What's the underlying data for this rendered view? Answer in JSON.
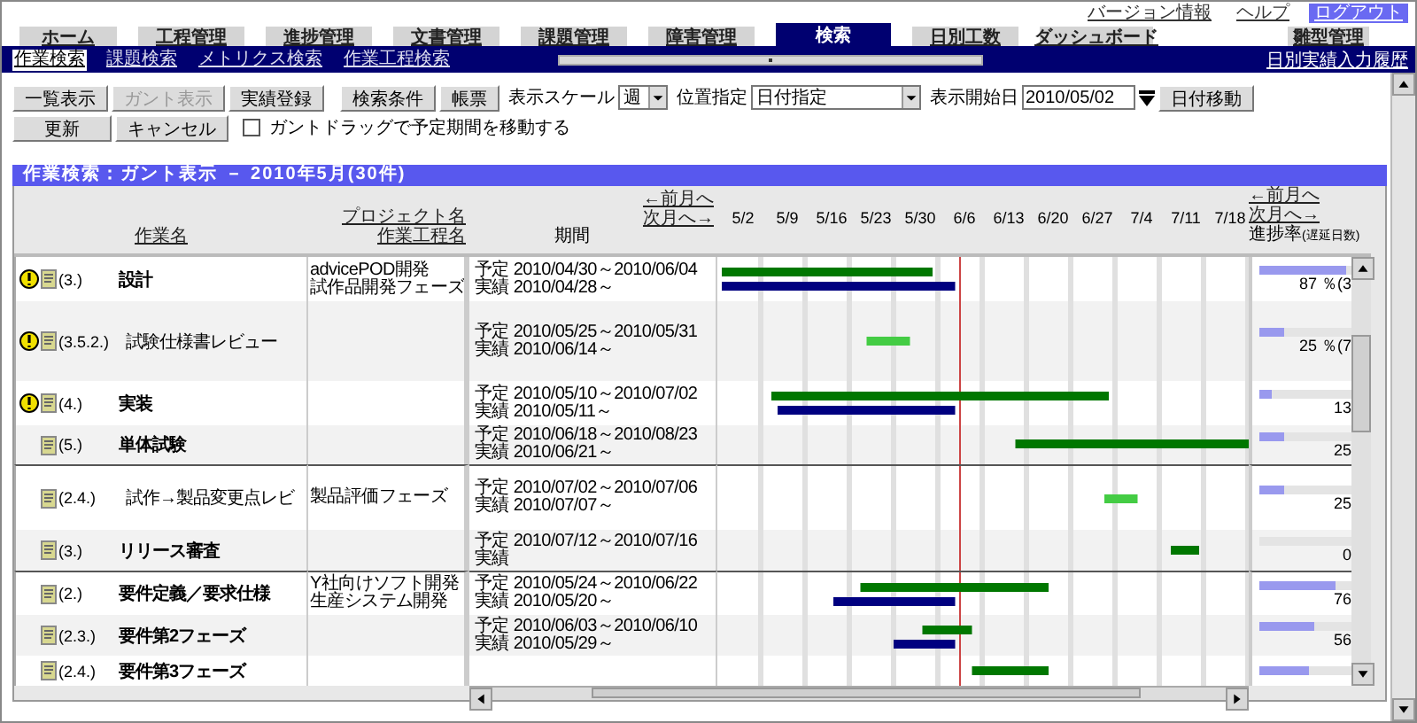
{
  "top_links": [
    {
      "label": "バージョン情報",
      "selected": false
    },
    {
      "label": "ヘルプ",
      "selected": false
    },
    {
      "label": "ログアウト",
      "selected": true
    }
  ],
  "tabs": [
    {
      "label": "ホーム",
      "selected": false
    },
    {
      "label": "工程管理",
      "selected": false
    },
    {
      "label": "進捗管理",
      "selected": false
    },
    {
      "label": "文書管理",
      "selected": false
    },
    {
      "label": "課題管理",
      "selected": false
    },
    {
      "label": "障害管理",
      "selected": false
    },
    {
      "label": "検索",
      "selected": true
    },
    {
      "label": "日別工数",
      "selected": false
    },
    {
      "label": "ダッシュボード",
      "selected": false
    }
  ],
  "tabs_right": [
    {
      "label": "雛型管理",
      "selected": false
    }
  ],
  "subtabs": [
    {
      "label": "作業検索",
      "selected": true
    },
    {
      "label": "課題検索",
      "selected": false
    },
    {
      "label": "メトリクス検索",
      "selected": false
    },
    {
      "label": "作業工程検索",
      "selected": false
    }
  ],
  "subnav_link": "日別実績入力履歴",
  "toolbar": {
    "buttons_row1": [
      {
        "label": "一覧表示",
        "disabled": false
      },
      {
        "label": "ガント表示",
        "disabled": true
      },
      {
        "label": "実績登録",
        "disabled": false
      },
      {
        "label": "検索条件",
        "disabled": false
      },
      {
        "label": "帳票",
        "disabled": false
      }
    ],
    "scale_label": "表示スケール",
    "scale_value": "週",
    "position_label": "位置指定",
    "position_value": "日付指定",
    "start_label": "表示開始日",
    "start_value": "2010/05/02",
    "move_button": "日付移動",
    "buttons_row2": [
      {
        "label": "更新",
        "disabled": false
      },
      {
        "label": "キャンセル",
        "disabled": false
      }
    ],
    "drag_option": {
      "label": "ガントドラッグで予定期間を移動する",
      "checked": false
    }
  },
  "panel_title": "作業検索：ガント表示 － 2010年5月(30件)",
  "header": {
    "task": "作業名",
    "project": "プロジェクト名",
    "phase": "作業工程名",
    "period": "期間",
    "prev": "←前月へ",
    "next": "次月へ→",
    "weeks": [
      "5/2",
      "5/9",
      "5/16",
      "5/23",
      "5/30",
      "6/6",
      "6/13",
      "6/20",
      "6/27",
      "7/4",
      "7/11",
      "7/18"
    ],
    "progress_prev": "←前月へ",
    "progress_next": "次月へ→",
    "progress": "進捗率",
    "progress_note": "(遅延日数)"
  },
  "rows": [
    {
      "alert": true,
      "summary": true,
      "number": "(3.)",
      "name": "設計",
      "project": "advicePOD開発",
      "phase": "試作品開発フェーズ",
      "plan": "予定 2010/04/30～2010/06/04",
      "actual": "実績 2010/04/28～",
      "level": 0.87,
      "progress": "87 ％(3"
    },
    {
      "alert": true,
      "summary": false,
      "number": "(3.5.2.)",
      "name": "試験仕様書レビュー",
      "plan": "予定 2010/05/25～2010/05/31",
      "actual": "実績 2010/06/14～",
      "level": 0.25,
      "progress": "25 ％(7"
    },
    {
      "alert": true,
      "summary": true,
      "number": "(4.)",
      "name": "実装",
      "plan": "予定 2010/05/10～2010/07/02",
      "actual": "実績 2010/05/11～",
      "level": 0.13,
      "progress": "13"
    },
    {
      "alert": false,
      "summary": true,
      "number": "(5.)",
      "name": "単体試験",
      "plan": "予定 2010/06/18～2010/08/23",
      "actual": "実績 2010/06/21～",
      "level": 0.25,
      "progress": "25"
    },
    {
      "alert": false,
      "summary": false,
      "number": "(2.4.)",
      "name": "試作→製品変更点レビ",
      "phase": "製品評価フェーズ",
      "plan": "予定 2010/07/02～2010/07/06",
      "actual": "実績 2010/07/07～",
      "level": 0.25,
      "progress": "25"
    },
    {
      "alert": false,
      "summary": true,
      "number": "(3.)",
      "name": "リリース審査",
      "plan": "予定 2010/07/12～2010/07/16",
      "actual": "実績",
      "level": 0,
      "progress": "0"
    },
    {
      "alert": false,
      "summary": true,
      "number": "(2.)",
      "name": "要件定義／要求仕様",
      "project": "Y社向けソフト開発",
      "phase": "生産システム開発",
      "plan": "予定 2010/05/24～2010/06/22",
      "actual": "実績 2010/05/20～",
      "level": 0.76,
      "progress": "76"
    },
    {
      "alert": false,
      "summary": true,
      "number": "(2.3.)",
      "name": "要件第2フェーズ",
      "plan": "予定 2010/06/03～2010/06/10",
      "actual": "実績 2010/05/29～",
      "level": 0.56,
      "progress": "56"
    },
    {
      "alert": false,
      "summary": true,
      "number": "(2.4.)",
      "name": "要件第3フェーズ",
      "level": 0.5
    }
  ]
}
